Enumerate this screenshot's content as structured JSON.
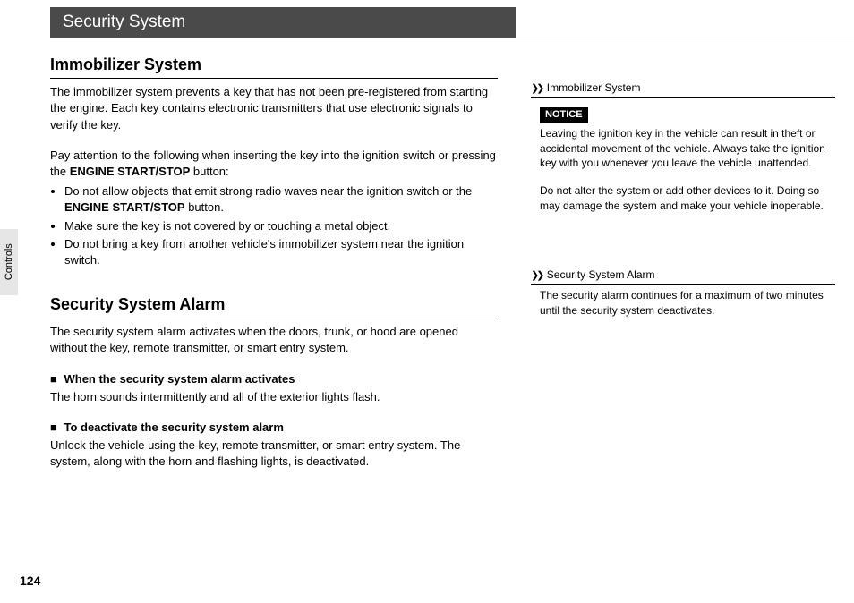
{
  "header": {
    "title": "Security System"
  },
  "sideTab": "Controls",
  "pageNumber": "124",
  "immobilizer": {
    "heading": "Immobilizer System",
    "p1a": "The immobilizer system prevents a key that has not been pre-registered from starting the engine. Each key contains electronic transmitters that use electronic signals to verify the key.",
    "p2_pre": "Pay attention to the following when inserting the key into the ignition switch or pressing the ",
    "p2_strong": "ENGINE START/STOP",
    "p2_post": " button:",
    "b1_pre": "Do not allow objects that emit strong radio waves near the ignition switch or the ",
    "b1_strong": "ENGINE START/STOP",
    "b1_post": " button.",
    "b2": "Make sure the key is not covered by or touching a metal object.",
    "b3": "Do not bring a key from another vehicle's immobilizer system near the ignition switch."
  },
  "alarm": {
    "heading": "Security System Alarm",
    "p1": "The security system alarm activates when the doors, trunk, or hood are opened without the key, remote transmitter, or smart entry system.",
    "sub1_h": "When the security system alarm activates",
    "sub1_p": "The horn sounds intermittently and all of the exterior lights flash.",
    "sub2_h": "To deactivate the security system alarm",
    "sub2_p": "Unlock the vehicle using the key, remote transmitter, or smart entry system. The system, along with the horn and flashing lights, is deactivated."
  },
  "sidebar": {
    "ref1": "Immobilizer System",
    "noticeLabel": "NOTICE",
    "notice_p1": "Leaving the ignition key in the vehicle can result in theft or accidental movement of the vehicle. Always take the ignition key with you whenever you leave the vehicle unattended.",
    "notice_p2": "Do not alter the system or add other devices to it. Doing so may damage the system and make your vehicle inoperable.",
    "ref2": "Security System Alarm",
    "side2_p": "The security alarm continues for a maximum of two minutes until the security system deactivates."
  }
}
